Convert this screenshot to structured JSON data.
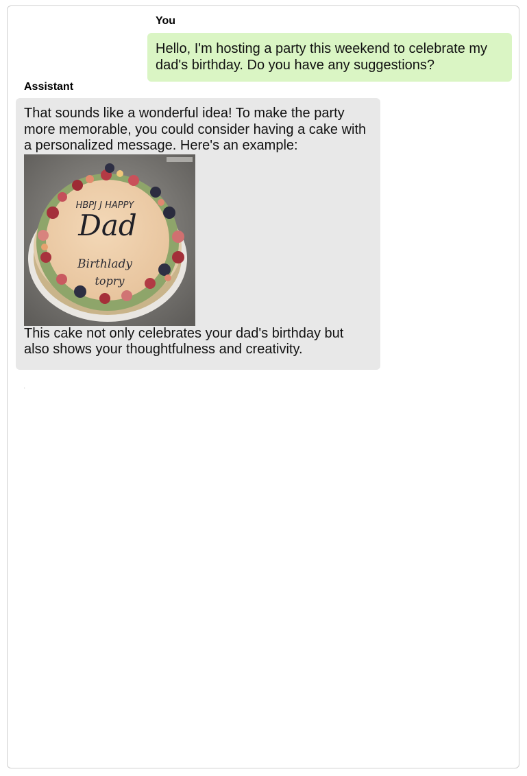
{
  "conversation": {
    "messages": [
      {
        "sender": "You",
        "text": "Hello, I'm hosting a party this weekend to celebrate my dad's birthday. Do you have any suggestions?"
      },
      {
        "sender": "Assistant",
        "text_before": "That sounds like a wonderful idea! To make the party more memorable, you could consider having a cake with a personalized message. Here's an example:",
        "text_after": "This cake not only celebrates your dad's birthday but also shows your thoughtfulness and creativity."
      }
    ],
    "trailing_mark": "."
  },
  "cake_image": {
    "line1": "HBPJ J HAPPY",
    "line2": "Dad",
    "line3": "Birthlady",
    "line4": "topry"
  },
  "colors": {
    "user_bubble": "#daf5c4",
    "assistant_bubble": "#e8e8e8",
    "frame_border": "#cfcfcf"
  }
}
